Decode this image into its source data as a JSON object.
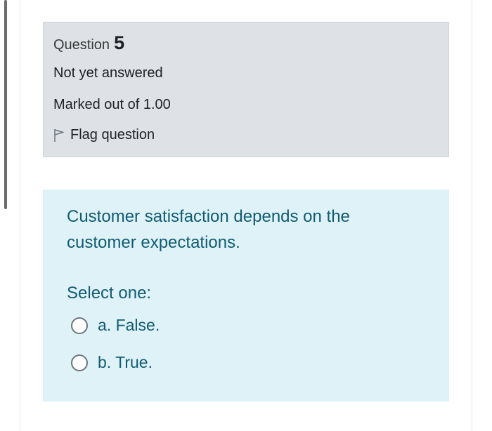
{
  "question": {
    "label": "Question",
    "number": "5",
    "state": "Not yet answered",
    "grade": "Marked out of 1.00",
    "flag_label": "Flag question",
    "flag_icon": "flag-outline-icon"
  },
  "content": {
    "text": "Customer satisfaction depends on the customer expectations.",
    "prompt": "Select one:",
    "options": [
      {
        "label": "a. False.",
        "selected": false
      },
      {
        "label": "b. True.",
        "selected": false
      }
    ]
  },
  "colors": {
    "info_bg": "#dee2e6",
    "content_bg": "#def2f8",
    "content_text": "#115c72"
  }
}
